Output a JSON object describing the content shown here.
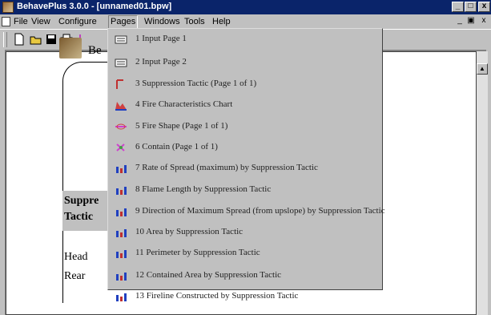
{
  "window": {
    "title": "BehavePlus 3.0.0 - [unnamed01.bpw]"
  },
  "window_controls": {
    "minimize": "_",
    "maximize": "□",
    "close": "x"
  },
  "mdi_controls": {
    "minimize": "_",
    "restore": "▣",
    "close": "x"
  },
  "menubar": {
    "items": [
      "File",
      "View",
      "Configure",
      "Pages",
      "Windows",
      "Tools",
      "Help"
    ],
    "active": "Pages"
  },
  "document": {
    "logo_text": "Be",
    "rows": [
      {
        "label": "Suppre",
        "bold": true
      },
      {
        "label": "Tactic",
        "bold": true
      },
      {
        "label": "Head",
        "bold": false
      },
      {
        "label": "Rear",
        "bold": false
      }
    ]
  },
  "pages_menu": [
    {
      "label": "1 Input Page 1",
      "icon": "input-page-icon"
    },
    {
      "label": "2 Input Page 2",
      "icon": "input-page-icon"
    },
    {
      "label": "3 Suppression Tactic (Page 1 of 1)",
      "icon": "table-page-icon"
    },
    {
      "label": "4 Fire Characteristics Chart",
      "icon": "fire-chart-icon"
    },
    {
      "label": "5 Fire Shape (Page 1 of 1)",
      "icon": "fire-shape-icon"
    },
    {
      "label": "6 Contain (Page 1 of 1)",
      "icon": "contain-icon"
    },
    {
      "label": "7 Rate of Spread (maximum) by Suppression Tactic",
      "icon": "bar-chart-icon"
    },
    {
      "label": "8 Flame Length by Suppression Tactic",
      "icon": "bar-chart-icon"
    },
    {
      "label": "9 Direction of Maximum Spread (from upslope) by Suppression Tactic",
      "icon": "bar-chart-icon"
    },
    {
      "label": "10 Area by Suppression Tactic",
      "icon": "bar-chart-icon"
    },
    {
      "label": "11 Perimeter by Suppression Tactic",
      "icon": "bar-chart-icon"
    },
    {
      "label": "12 Contained Area by Suppression Tactic",
      "icon": "bar-chart-icon"
    },
    {
      "label": "13 Fireline Constructed by Suppression Tactic",
      "icon": "bar-chart-icon"
    }
  ]
}
